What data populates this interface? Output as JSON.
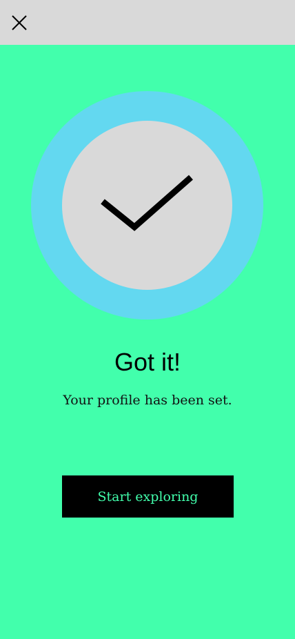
{
  "header": {
    "close_icon": "close-icon"
  },
  "illustration": {
    "icon": "checkmark-icon",
    "ring_color": "#63d8f0",
    "inner_color": "#d9d9d9"
  },
  "content": {
    "title": "Got it!",
    "subtitle": "Your profile has been set."
  },
  "actions": {
    "primary_label": "Start exploring"
  },
  "colors": {
    "background": "#42ffac",
    "header": "#d9d9d9",
    "button_bg": "#000000",
    "button_text": "#42ffac"
  }
}
